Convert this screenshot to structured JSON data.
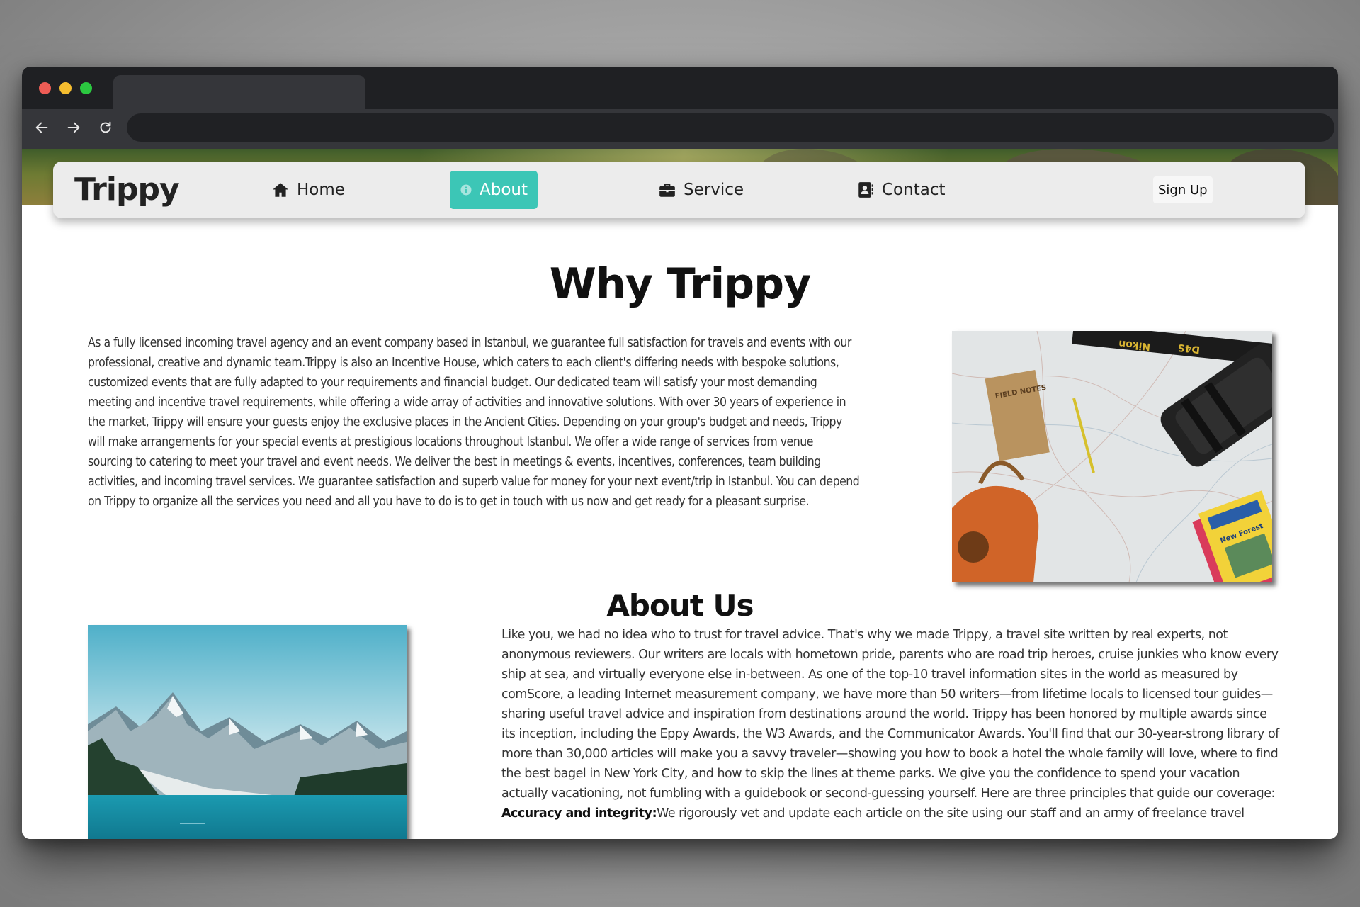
{
  "browser": {
    "icons": [
      "back-arrow-icon",
      "forward-arrow-icon",
      "reload-icon"
    ]
  },
  "navbar": {
    "brand": "Trippy",
    "items": [
      {
        "label": "Home",
        "icon": "home-icon"
      },
      {
        "label": "About",
        "icon": "info-circle-icon",
        "active": true
      },
      {
        "label": "Service",
        "icon": "briefcase-icon"
      },
      {
        "label": "Contact",
        "icon": "contact-card-icon"
      }
    ],
    "signup_label": "Sign Up",
    "active_color": "#3cc6b6"
  },
  "why": {
    "title": "Why Trippy",
    "body": "As a fully licensed incoming travel agency and an event company based in Istanbul, we guarantee full satisfaction for travels and events with our professional, creative and dynamic team.Trippy is also an Incentive House, which caters to each client's differing needs with bespoke solutions, customized events that are fully adapted to your requirements and financial budget. Our dedicated team will satisfy your most demanding meeting and incentive travel requirements, while offering a wide array of activities and innovative solutions. With over 30 years of experience in the market, Trippy will ensure your guests enjoy the exclusive places in the Ancient Cities. Depending on your group's budget and needs, Trippy will make arrangements for your special events at prestigious locations throughout Istanbul. We offer a wide range of services from venue sourcing to catering to meet your travel and event needs. We deliver the best in meetings & events, incentives, conferences, team building activities, and incoming travel services. We guarantee satisfaction and superb value for money for your next event/trip in Istanbul. You can depend on Trippy to organize all the services you need and all you have to do is to get in touch with us now and get ready for a pleasant surprise."
  },
  "about": {
    "title": "About Us",
    "body": "Like you, we had no idea who to trust for travel advice. That's why we made Trippy, a travel site written by real experts, not anonymous reviewers. Our writers are locals with hometown pride, parents who are road trip heroes, cruise junkies who know every ship at sea, and virtually everyone else in-between. As one of the top-10 travel information sites in the world as measured by comScore, a leading Internet measurement company, we have more than 50 writers—from lifetime locals to licensed tour guides—sharing useful travel advice and inspiration from destinations around the world. Trippy has been honored by multiple awards since its inception, including the Eppy Awards, the W3 Awards, and the Communicator Awards. You'll find that our 30-year-strong library of more than 30,000 articles will make you a savvy traveler—showing you how to book a hotel the whole family will love, where to find the best bagel in New York City, and how to skip the lines at theme parks. We give you the confidence to spend your vacation actually vacationing, not fumbling with a guidebook or second-guessing yourself. Here are three principles that guide our coverage:",
    "principle_title": "Accuracy and integrity:",
    "principle_text": "We rigorously vet and update each article on the site using our staff and an army of freelance travel"
  },
  "images": {
    "travel_flatlay": {
      "camera_strap_text": "Nikon",
      "camera_model_text": "D4S",
      "notebook_text": "FIELD NOTES",
      "guide_text": "New Forest"
    }
  }
}
